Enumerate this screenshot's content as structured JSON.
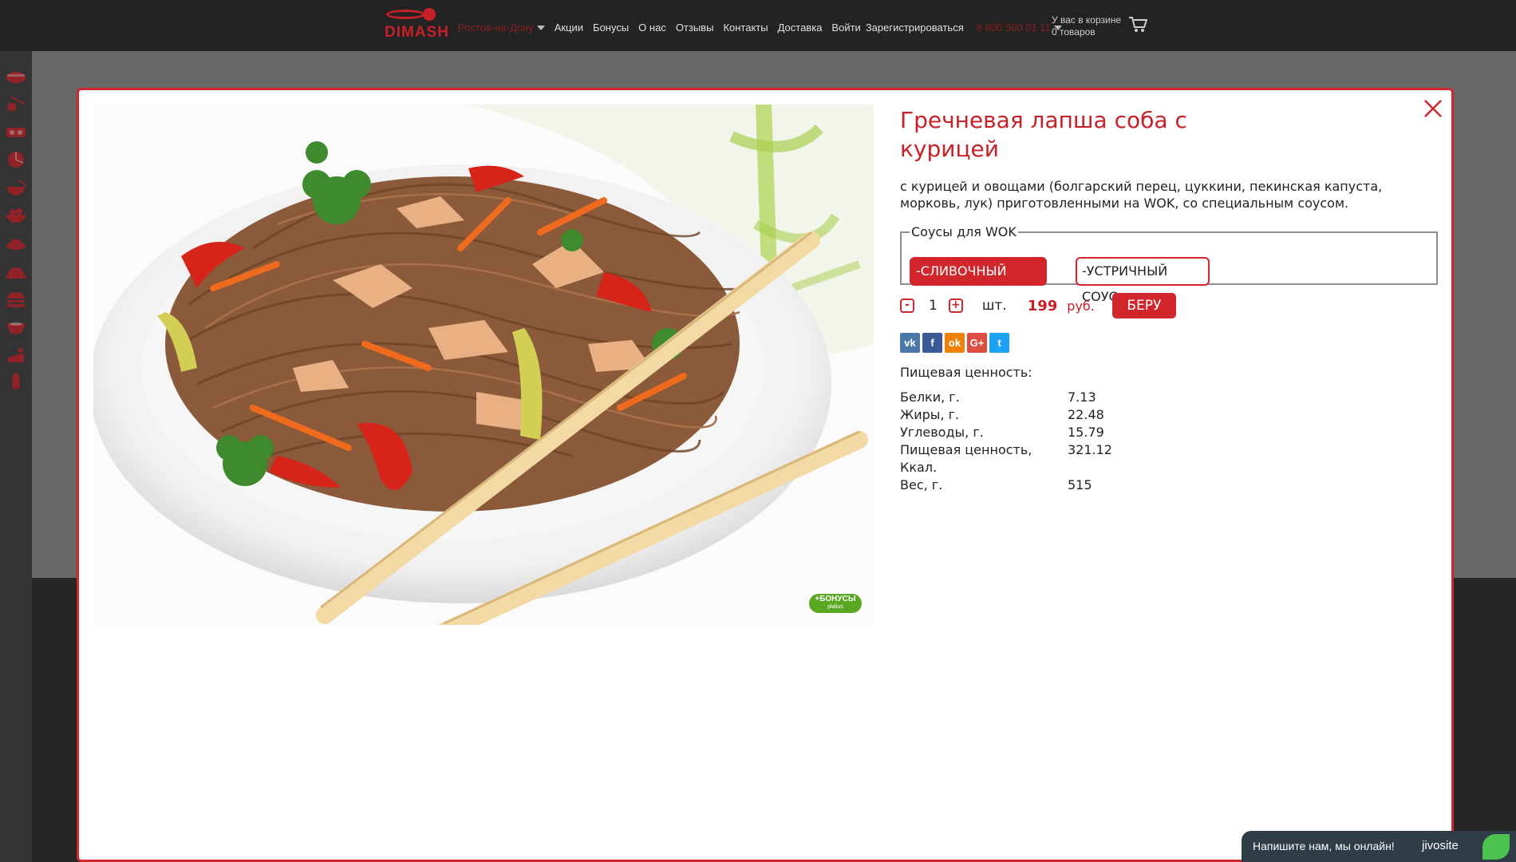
{
  "header": {
    "logo_text": "DIMASH",
    "city": "Ростов-на-Дону",
    "nav": [
      "Акции",
      "Бонусы",
      "О нас",
      "Отзывы",
      "Контакты",
      "Доставка",
      "Войти",
      "Зарегистрироваться"
    ],
    "phone": "8 800 500 01 11",
    "cart_line1": "У вас в корзине",
    "cart_line2": "0 товаров"
  },
  "modal": {
    "title": "Гречневая лапша соба с курицей",
    "description": "с курицей и овощами (болгарский перец, цуккини, пекинская капуста, морковь, лук) приготовленными на WOK, со специальным соусом.",
    "sauces_legend": "Соусы для WOK",
    "sauces": [
      {
        "label": "-СЛИВОЧНЫЙ СОУС",
        "selected": true
      },
      {
        "label": "-УСТРИЧНЫЙ СОУС",
        "selected": false
      }
    ],
    "quantity": "1",
    "unit": "шт.",
    "price": "199",
    "currency": "руб.",
    "buy_label": "БЕРУ",
    "bonus_badge": "+БОНУСЫ",
    "bonus_sub": "plalius",
    "social": [
      {
        "icon": "vk-icon",
        "glyph": "vk",
        "color": "#4a76a8"
      },
      {
        "icon": "facebook-icon",
        "glyph": "f",
        "color": "#3b5998"
      },
      {
        "icon": "odnoklassniki-icon",
        "glyph": "ok",
        "color": "#ee8208"
      },
      {
        "icon": "googleplus-icon",
        "glyph": "G+",
        "color": "#dc4e41"
      },
      {
        "icon": "twitter-icon",
        "glyph": "t",
        "color": "#1da1f2"
      }
    ],
    "nutrition_title": "Пищевая ценность:",
    "nutrition": [
      {
        "label": "Белки, г.",
        "value": "7.13"
      },
      {
        "label": "Жиры, г.",
        "value": "22.48"
      },
      {
        "label": "Углеводы, г.",
        "value": "15.79"
      },
      {
        "label": "Пищевая ценность, Ккал.",
        "value": "321.12"
      },
      {
        "label": "Вес, г.",
        "value": "515"
      }
    ]
  },
  "chat": {
    "prompt": "Напишите нам, мы онлайн!",
    "brand": "jivosite"
  },
  "colors": {
    "accent": "#d0262c",
    "header_bg": "#232323",
    "bonus_green": "#5aa822"
  }
}
